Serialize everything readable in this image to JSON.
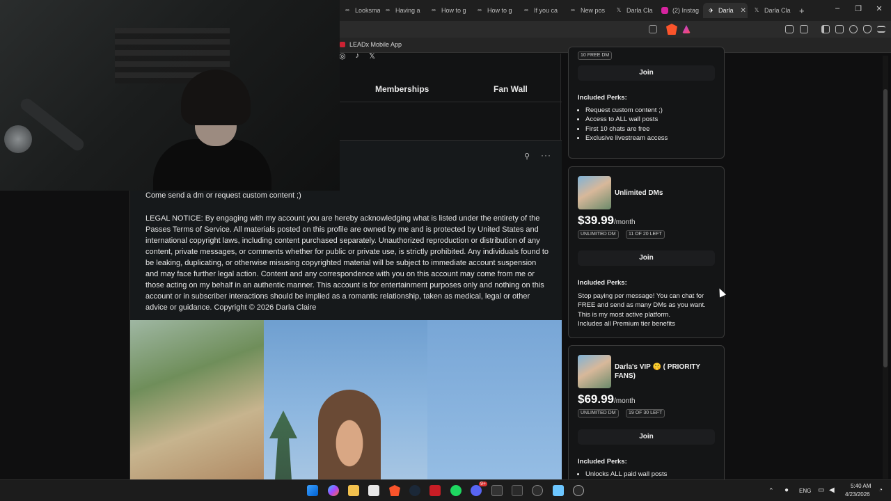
{
  "browser": {
    "tabs": [
      {
        "label": "Looksma",
        "icon": "infinity-icon"
      },
      {
        "label": "Having a",
        "icon": "infinity-icon"
      },
      {
        "label": "How to g",
        "icon": "infinity-icon"
      },
      {
        "label": "How to g",
        "icon": "infinity-icon"
      },
      {
        "label": "If you ca",
        "icon": "infinity-icon"
      },
      {
        "label": "New pos",
        "icon": "infinity-icon"
      },
      {
        "label": "Darla Cla",
        "icon": "x-icon"
      },
      {
        "label": "(2) Instag",
        "icon": "instagram-icon"
      },
      {
        "label": "Darla",
        "icon": "passes-icon",
        "active": true
      },
      {
        "label": "Darla Cla",
        "icon": "x-icon"
      }
    ],
    "new_tab": "+",
    "window_controls": {
      "minimize": "–",
      "maximize": "❐",
      "close": "✕"
    },
    "bookmark": "LEADx Mobile App"
  },
  "profile": {
    "social_icons": [
      "instagram-icon",
      "tiktok-icon",
      "x-icon"
    ],
    "social_glyphs": [
      "◎",
      "♪",
      "𝕏"
    ],
    "nav_tabs": {
      "memberships": "Memberships",
      "fan_wall": "Fan Wall"
    }
  },
  "post": {
    "pin_glyph": "⚲",
    "more_glyph": "···",
    "title": "Come send a dm or request custom content ;)",
    "body": "LEGAL NOTICE: By engaging with my account you are hereby acknowledging what is listed under the entirety of the Passes Terms of Service. All materials posted on this profile are owned by me and is protected by United States and international copyright laws, including content purchased separately. Unauthorized reproduction or distribution of any content, private messages, or comments whether for public or private use, is strictly prohibited. Any individuals found to be leaking, duplicating, or otherwise misusing copyrighted material will be subject to immediate account suspension and may face further legal action. Content and any correspondence with you on this account may come from me or those acting on my behalf in an authentic manner. This account is for entertainment purposes only and nothing on this account or in subscriber interactions should be implied as a romantic relationship, taken as medical, legal or other advice or guidance. Copyright © 2026 Darla Claire"
  },
  "tiers": {
    "tier1": {
      "badge": "10 FREE DM",
      "join": "Join",
      "perks_heading": "Included Perks:",
      "perks": [
        "Request custom content ;)",
        "Access to ALL wall posts",
        "First 10 chats are free",
        "Exclusive livestream access"
      ]
    },
    "tier2": {
      "name": "Unlimited DMs",
      "price": "$39.99",
      "period": "/month",
      "badges": [
        "UNLIMITED DM",
        "11 OF 20 LEFT"
      ],
      "join": "Join",
      "perks_heading": "Included Perks:",
      "perks_text_1": "Stop paying per message! You can chat for FREE and send as many DMs as you want. This is my most active platform.",
      "perks_text_2": "Includes all Premium tier benefits"
    },
    "tier3": {
      "name": "Darla's VIP 🤫 ( PRIORITY FANS)",
      "price": "$69.99",
      "period": "/month",
      "badges": [
        "UNLIMITED DM",
        "19 OF 30 LEFT"
      ],
      "join": "Join",
      "perks_heading": "Included Perks:",
      "perks": [
        "Unlocks ALL paid wall posts"
      ]
    }
  },
  "taskbar": {
    "language": "ENG",
    "time": "5:40 AM",
    "date": "4/23/2026",
    "notification_badge": "9+"
  },
  "colors": {
    "page_bg": "#0f0f10",
    "card_border": "#3a3a3a",
    "accent_brave": "#fb542b"
  }
}
